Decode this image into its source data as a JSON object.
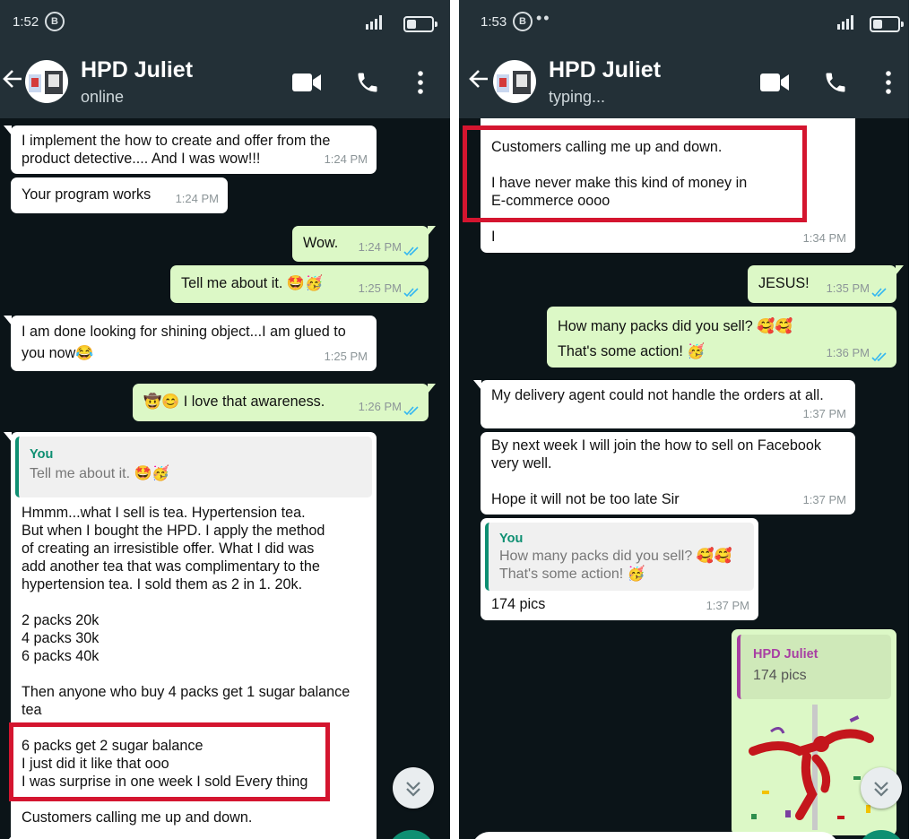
{
  "left": {
    "status": {
      "time": "1:52",
      "badge": "B"
    },
    "header": {
      "name": "HPD Juliet",
      "status": "online"
    },
    "messages": {
      "m1": {
        "text": "I implement the how to create and offer from the\nproduct detective.... And I was wow!!!",
        "time": "1:24 PM"
      },
      "m2": {
        "text": "Your program works",
        "time": "1:24 PM"
      },
      "m3": {
        "text": "Wow.",
        "time": "1:24 PM"
      },
      "m4": {
        "text": "Tell me about it. 🤩🥳",
        "time": "1:25 PM"
      },
      "m5": {
        "text": "I am done looking for shining object...I am glued to\nyou now😂",
        "time": "1:25 PM"
      },
      "m6": {
        "text": "🤠😊 I love that awareness.",
        "time": "1:26 PM"
      },
      "m7": {
        "quote_author": "You",
        "quote_text": "Tell me about it. 🤩🥳",
        "text": "Hmmm...what I sell is tea. Hypertension tea.\nBut when I bought the HPD. I apply the method\nof creating an irresistible offer. What I did was\nadd another tea that was complimentary to the\nhypertension tea. I sold them as 2 in 1. 20k.\n\n2 packs 20k\n4 packs 30k\n6 packs 40k\n\nThen anyone who buy 4 packs get 1 sugar balance\ntea\n\n6 packs get 2 sugar balance\nI just did it like that ooo\nI was surprise in one week I sold Every thing\n\nCustomers calling me up and down."
      }
    }
  },
  "right": {
    "status": {
      "time": "1:53",
      "badge": "B",
      "dots": "••"
    },
    "header": {
      "name": "HPD Juliet",
      "status": "typing..."
    },
    "messages": {
      "r1": {
        "text": "Customers calling me up and down.\n\nI have never make this kind of money in\nE-commerce oooo\n\nI",
        "time": "1:34 PM"
      },
      "r2": {
        "text": "JESUS!",
        "time": "1:35 PM"
      },
      "r3": {
        "text": "How many packs did you sell? 🥰🥰\nThat's some action! 🥳",
        "time": "1:36 PM"
      },
      "r4": {
        "text": "My delivery agent could not handle the orders at all.",
        "time": "1:37 PM"
      },
      "r5": {
        "text": "By next week I will join the how to sell on Facebook\nvery well.\n\nHope it will not be too late Sir",
        "time": "1:37 PM"
      },
      "r6": {
        "quote_author": "You",
        "quote_text": "How many packs did you sell? 🥰🥰\nThat's some action! 🥳",
        "text": "174 pics",
        "time": "1:37 PM"
      },
      "r7": {
        "quote_author": "HPD Juliet",
        "quote_text": "174 pics"
      }
    }
  },
  "colors": {
    "header_bg": "#233037",
    "chat_bg": "#0b1418",
    "incoming_bubble": "#ffffff",
    "outgoing_bubble": "#dcf8c6",
    "accent_green": "#0e8f72",
    "read_ticks": "#34b7f1",
    "highlight_red": "#d4152f"
  },
  "icons": [
    "back-arrow-icon",
    "video-call-icon",
    "phone-icon",
    "more-menu-icon",
    "double-check-icon",
    "scroll-down-icon",
    "signal-icon",
    "battery-icon",
    "dancing-sticker"
  ]
}
